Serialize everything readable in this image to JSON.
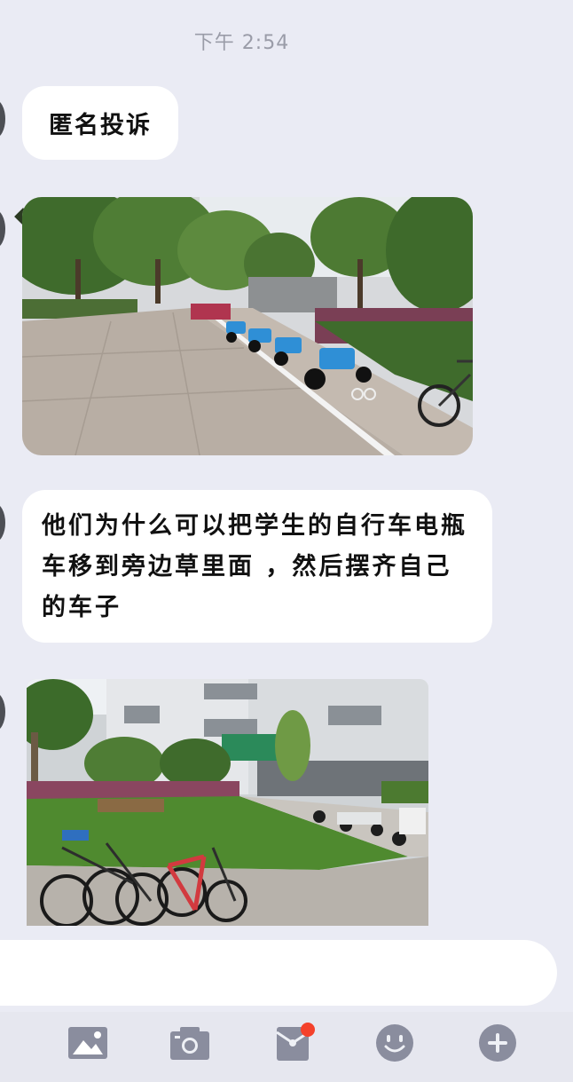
{
  "chat": {
    "timestamp": "下午 2:54",
    "messages": [
      {
        "type": "text",
        "text": "匿名投诉"
      },
      {
        "type": "image",
        "icon": "photo-bike-parking-path"
      },
      {
        "type": "text",
        "text": "他们为什么可以把学生的自行车电瓶车移到旁边草里面 ，然后摆齐自己的车子"
      },
      {
        "type": "image",
        "icon": "photo-bikes-on-grass"
      }
    ]
  },
  "toolbar": {
    "icons": [
      "image-icon",
      "camera-icon",
      "red-packet-icon",
      "emoji-icon",
      "plus-icon"
    ],
    "badge_color": "#f4412b",
    "icon_color": "#8a8d9e"
  }
}
